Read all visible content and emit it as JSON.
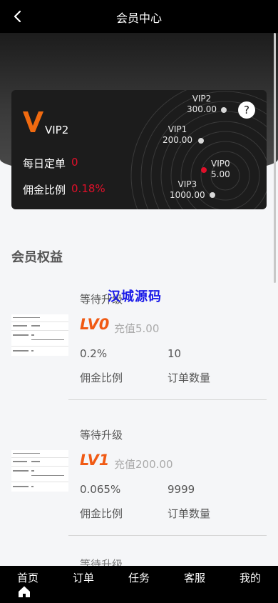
{
  "navbar": {
    "title": "会员中心"
  },
  "card": {
    "current_level": "VIP2",
    "daily_orders_label": "每日定单",
    "daily_orders_value": "0",
    "commission_label": "佣金比例",
    "commission_value": "0.18%",
    "help": "?",
    "nodes": [
      {
        "name": "VIP2",
        "amount": "300.00"
      },
      {
        "name": "VIP1",
        "amount": "200.00"
      },
      {
        "name": "VIP0",
        "amount": "5.00"
      },
      {
        "name": "VIP3",
        "amount": "1000.00"
      }
    ],
    "colors": {
      "highlight": "#e0102a",
      "logo": "#f06a10"
    }
  },
  "section": {
    "title": "会员权益"
  },
  "watermark": "汉城源码",
  "benefits": [
    {
      "status": "等待升级",
      "level": "LV0",
      "recharge": "充值5.00",
      "commission": "0.2%",
      "orders": "10",
      "commission_label": "佣金比例",
      "orders_label": "订单数量"
    },
    {
      "status": "等待升级",
      "level": "LV1",
      "recharge": "充值200.00",
      "commission": "0.065%",
      "orders": "9999",
      "commission_label": "佣金比例",
      "orders_label": "订单数量"
    }
  ],
  "next_status_partial": "等待升级",
  "tabbar": {
    "items": [
      "首页",
      "订单",
      "任务",
      "客服",
      "我的"
    ],
    "active_icon": "home-icon"
  }
}
